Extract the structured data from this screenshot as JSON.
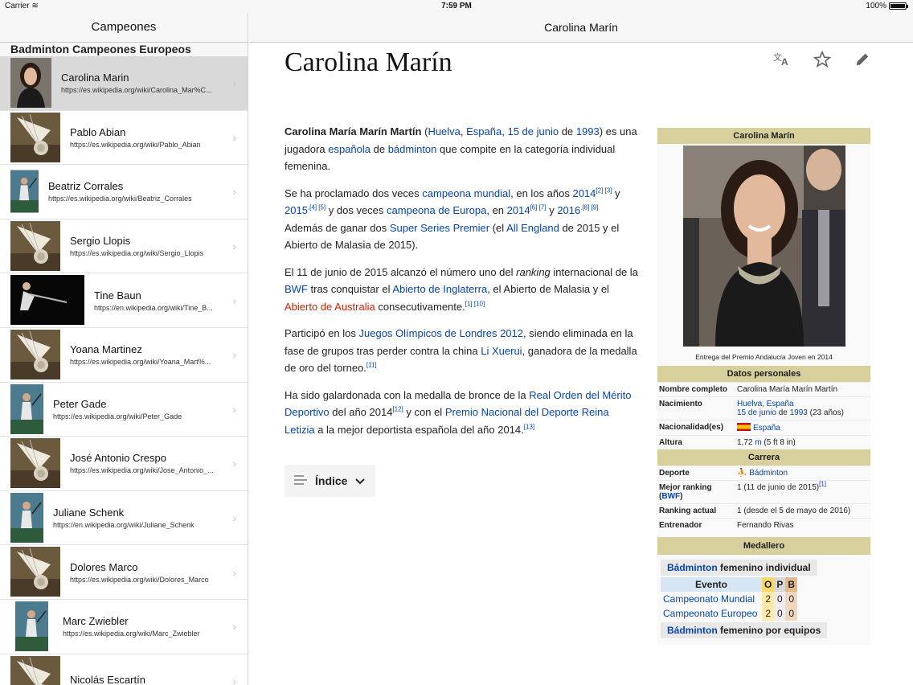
{
  "status": {
    "carrier": "Carrier",
    "time": "7:59 PM",
    "battery": "100%",
    "battery_level": 1.0
  },
  "sidebar": {
    "title": "Campeones",
    "section": "Badminton Campeones Europeos",
    "items": [
      {
        "name": "Carolina Marin",
        "url": "https://es.wikipedia.org/wiki/Carolina_Mar%C...",
        "selected": true
      },
      {
        "name": "Pablo Abian",
        "url": "https://es.wikipedia.org/wiki/Pablo_Abian"
      },
      {
        "name": "Beatriz Corrales",
        "url": "https://es.wikipedia.org/wiki/Beatriz_Corrales"
      },
      {
        "name": "Sergio Llopis",
        "url": "https://es.wikipedia.org/wiki/Sergio_Llopis"
      },
      {
        "name": "Tine Baun",
        "url": "https://en.wikipedia.org/wiki/Tine_B..."
      },
      {
        "name": "Yoana Martinez",
        "url": "https://es.wikipedia.org/wiki/Yoana_Mart%..."
      },
      {
        "name": "Peter Gade",
        "url": "https://es.wikipedia.org/wiki/Peter_Gade"
      },
      {
        "name": "José Antonio Crespo",
        "url": "https://es.wikipedia.org/wiki/Jose_Antonio_..."
      },
      {
        "name": "Juliane Schenk",
        "url": "https://en.wikipedia.org/wiki/Juliane_Schenk"
      },
      {
        "name": "Dolores Marco",
        "url": "https://es.wikipedia.org/wiki/Dolores_Marco"
      },
      {
        "name": "Marc Zwiebler",
        "url": "https://es.wikipedia.org/wiki/Marc_Zwiebler"
      },
      {
        "name": "Nicolás Escartín",
        "url": ""
      }
    ]
  },
  "topbar": {
    "title": "Carolina Marín"
  },
  "article": {
    "title": "Carolina Marín",
    "indice": "Índice",
    "p1": {
      "bold": "Carolina María Marín Martín",
      "t1": " (",
      "l1": "Huelva",
      "t2": ", ",
      "l2": "España",
      "t3": ", ",
      "l3": "15 de junio",
      "t4": " de ",
      "l4": "1993",
      "t5": ") es una jugadora ",
      "l5": "española",
      "t6": " de ",
      "l6": "bádminton",
      "t7": " que compite en la categoría individual femenina."
    },
    "p2": {
      "t1": "Se ha proclamado dos veces ",
      "l1": "campeona mundial",
      "t2": ", en los años ",
      "l2": "2014",
      "s1": "[2] [3]",
      "t3": " y ",
      "l3": "2015",
      "s2": ",[4] [5]",
      "t4": " y dos veces ",
      "l4": "campeona de Europa",
      "t5": ", en ",
      "l5": "2014",
      "s3": "[6] [7]",
      "t6": " y ",
      "l6": "2016",
      "s4": ".[8] [9]",
      "t7": " Además de ganar dos ",
      "l7": "Super Series Premier",
      "t8": " (el ",
      "l8": "All England",
      "t9": " de 2015 y el Abierto de Malasia de 2015)."
    },
    "p3": {
      "t1": "El 11 de junio de 2015 alcanzó el número uno del ",
      "i1": "ranking",
      "t2": " internacional de la ",
      "l1": "BWF",
      "t3": " tras conquistar el ",
      "l2": "Abierto de Inglaterra",
      "t4": ", el Abierto de Malasia y el ",
      "r1": "Abierto de Australia",
      "t5": " consecutivamente.",
      "s1": "[1] [10]"
    },
    "p4": {
      "t1": "Participó en los ",
      "l1": "Juegos Olímpicos de Londres 2012",
      "t2": ", siendo eliminada en la fase de grupos tras perder contra la china ",
      "l2": "Li Xuerui",
      "t3": ", ganadora de la medalla de oro del torneo.",
      "s1": "[11]"
    },
    "p5": {
      "t1": "Ha sido galardonada con la medalla de bronce de la ",
      "l1": "Real Orden del Mérito Deportivo",
      "t2": " del año 2014",
      "s1": "[12]",
      "t3": " y con el ",
      "l2": "Premio Nacional del Deporte Reina Letizia",
      "t4": " a la mejor deportista española del año 2014.",
      "s2": "[13]"
    }
  },
  "infobox": {
    "name": "Carolina Marín",
    "caption": "Entrega del Premio Andalucía Joven en 2014",
    "personal": "Datos personales",
    "nombre_k": "Nombre completo",
    "nombre_v": "Carolina María Marín Martín",
    "nac_k": "Nacimiento",
    "nac_l1": "Huelva, España",
    "nac_l2": "15 de junio",
    "nac_t1": " de ",
    "nac_l3": "1993",
    "nac_t2": " (23 años)",
    "nacionalidad_k": "Nacionalidad(es)",
    "nacionalidad_v": "España",
    "altura_k": "Altura",
    "altura_v1": "1,72 ",
    "altura_l": "m",
    "altura_v2": " (5 ft 8 in)",
    "carrera": "Carrera",
    "deporte_k": "Deporte",
    "deporte_v": "Bádminton",
    "mejor_k1": "Mejor ranking",
    "mejor_k2": "(",
    "mejor_kl": "BWF",
    "mejor_k3": ")",
    "mejor_v": "1 (11 de junio de 2015)",
    "mejor_s": "[1]",
    "actual_k": "Ranking actual",
    "actual_v": "1 (desde el 5 de mayo de 2016)",
    "entrenador_k": "Entrenador",
    "entrenador_v": "Fernando Rivas",
    "medallero": "Medallero",
    "cat1_l": "Bádminton",
    "cat1_t": " femenino individual",
    "evento": "Evento",
    "o": "O",
    "p": "P",
    "b": "B",
    "rows": [
      {
        "event": "Campeonato Mundial",
        "o": "2",
        "p": "0",
        "b": "0"
      },
      {
        "event": "Campeonato Europeo",
        "o": "2",
        "p": "0",
        "b": "0"
      }
    ],
    "cat2_l": "Bádminton",
    "cat2_t": " femenino por equipos"
  }
}
